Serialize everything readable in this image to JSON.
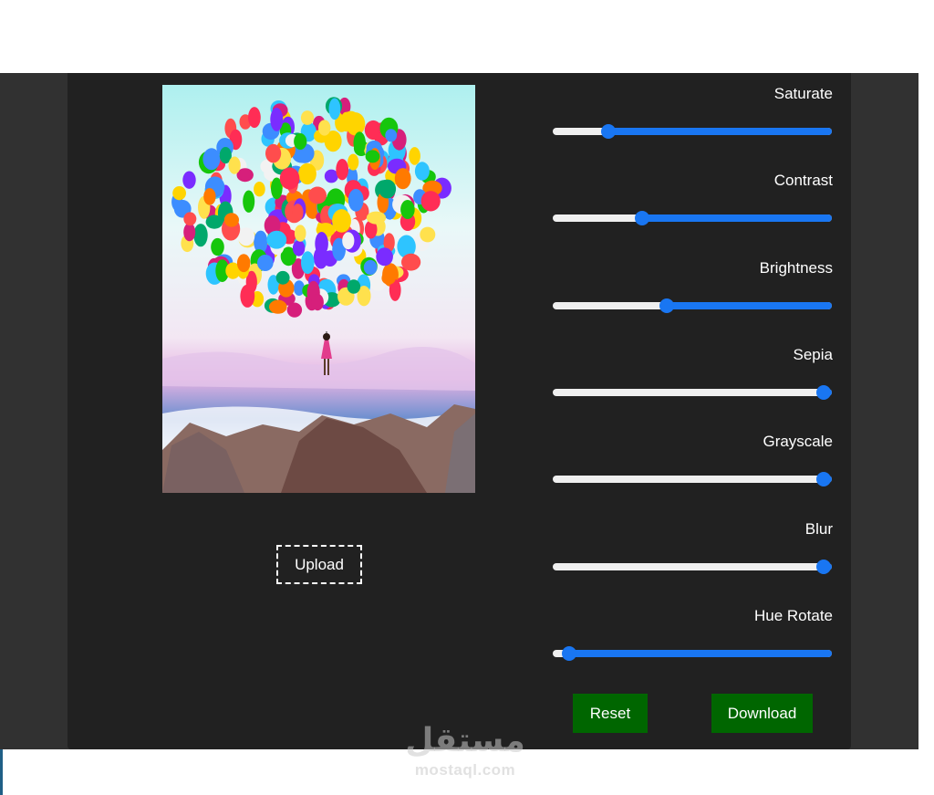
{
  "preview": {
    "image_desc_icon": "balloons-image"
  },
  "upload": {
    "label": "Upload"
  },
  "filters": [
    {
      "id": "saturate",
      "label": "Saturate",
      "value": 0.2
    },
    {
      "id": "contrast",
      "label": "Contrast",
      "value": 0.32
    },
    {
      "id": "brightness",
      "label": "Brightness",
      "value": 0.41
    },
    {
      "id": "sepia",
      "label": "Sepia",
      "value": 0.97
    },
    {
      "id": "grayscale",
      "label": "Grayscale",
      "value": 0.97
    },
    {
      "id": "blur",
      "label": "Blur",
      "value": 0.97
    },
    {
      "id": "hue-rotate",
      "label": "Hue Rotate",
      "value": 0.06
    }
  ],
  "actions": {
    "reset_label": "Reset",
    "download_label": "Download"
  },
  "watermark": {
    "logo": "مستقل",
    "text": "mostaql.com"
  },
  "colors": {
    "accent": "#1976f2",
    "button": "#006600",
    "panel": "#212121",
    "outer": "#313131"
  }
}
